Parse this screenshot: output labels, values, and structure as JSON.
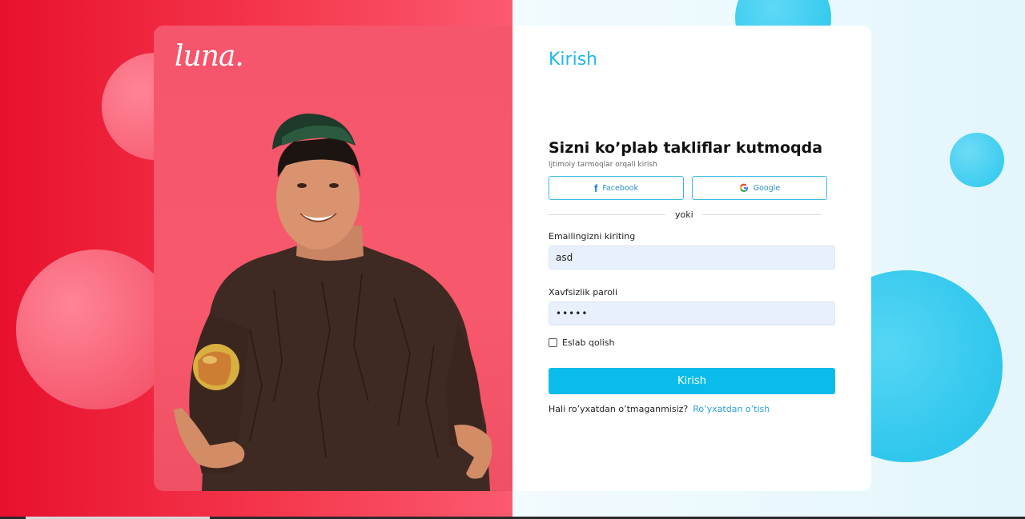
{
  "brand": {
    "logo_text": "luna."
  },
  "form": {
    "page_title": "Kirish",
    "headline": "Sizni ko’plab takliflar kutmoqda",
    "subline": "Ijtimoiy tarmoqlar orqali kirish",
    "social": {
      "facebook_label": "Facebook",
      "google_label": "Google"
    },
    "divider_text": "yoki",
    "email": {
      "label": "Emailingizni kiriting",
      "value": "asd"
    },
    "password": {
      "label": "Xavfsizlik paroli",
      "value": "•••••"
    },
    "remember_label": "Eslab qolish",
    "submit_label": "Kirish",
    "register": {
      "question": "Hali ro’yxatdan o’tmaganmisiz?",
      "link": "Ro’yxatdan o’tish"
    }
  },
  "colors": {
    "accent": "#0bbcea",
    "left_panel": "#f5384e",
    "facebook": "#1877f2"
  }
}
